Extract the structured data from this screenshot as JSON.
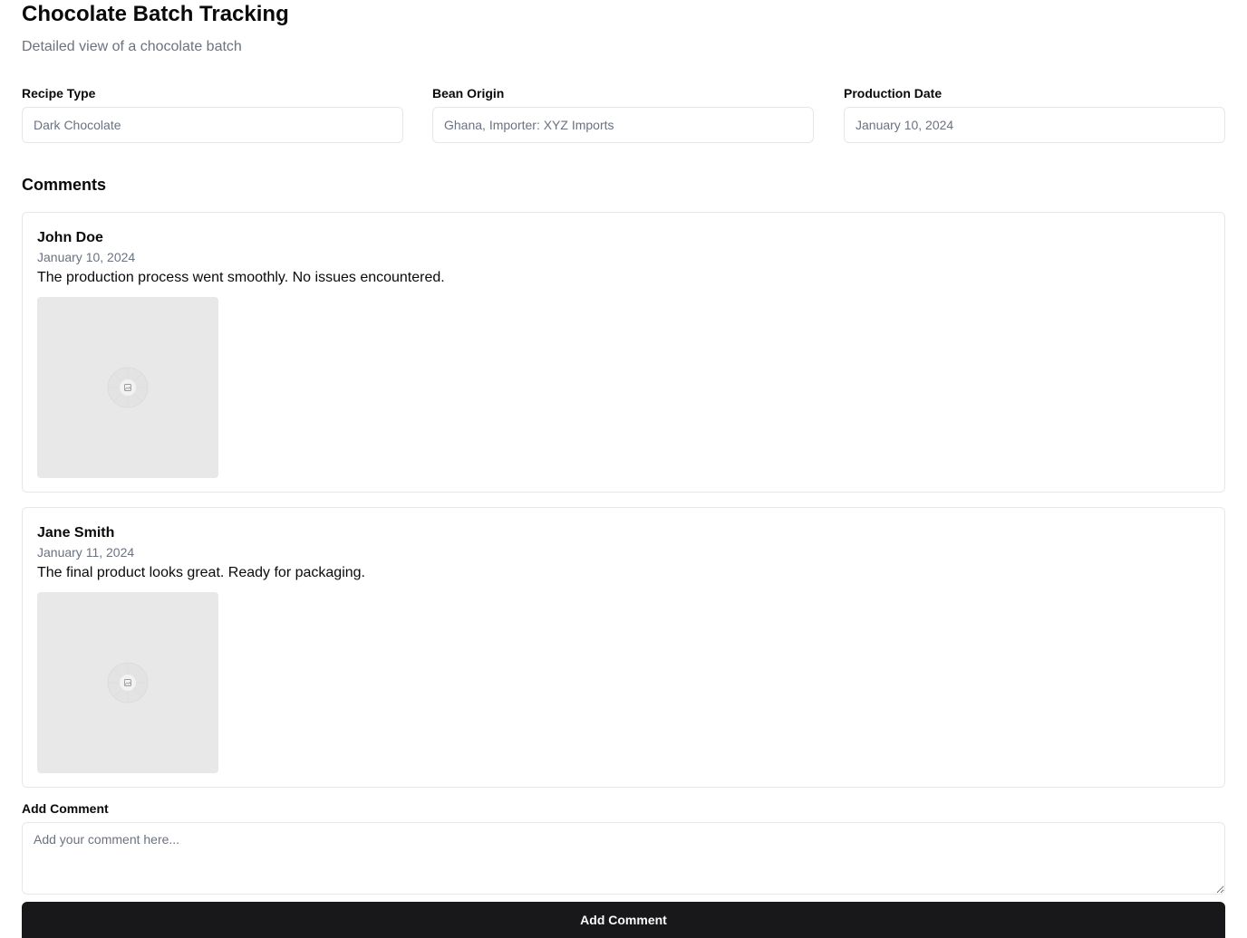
{
  "header": {
    "title": "Chocolate Batch Tracking",
    "subtitle": "Detailed view of a chocolate batch"
  },
  "fields": [
    {
      "label": "Recipe Type",
      "value": "Dark Chocolate"
    },
    {
      "label": "Bean Origin",
      "value": "Ghana, Importer: XYZ Imports"
    },
    {
      "label": "Production Date",
      "value": "January 10, 2024"
    }
  ],
  "comments_section": {
    "title": "Comments",
    "items": [
      {
        "author": "John Doe",
        "date": "January 10, 2024",
        "text": "The production process went smoothly. No issues encountered.",
        "image_icon": "image-placeholder-icon"
      },
      {
        "author": "Jane Smith",
        "date": "January 11, 2024",
        "text": "The final product looks great. Ready for packaging.",
        "image_icon": "image-placeholder-icon"
      }
    ]
  },
  "add_comment": {
    "label": "Add Comment",
    "placeholder": "Add your comment here...",
    "button_label": "Add Comment"
  },
  "colors": {
    "primary_button": "#18181b",
    "muted_text": "#6b7280",
    "border": "#e5e7eb",
    "image_placeholder": "#e8e8e8"
  }
}
